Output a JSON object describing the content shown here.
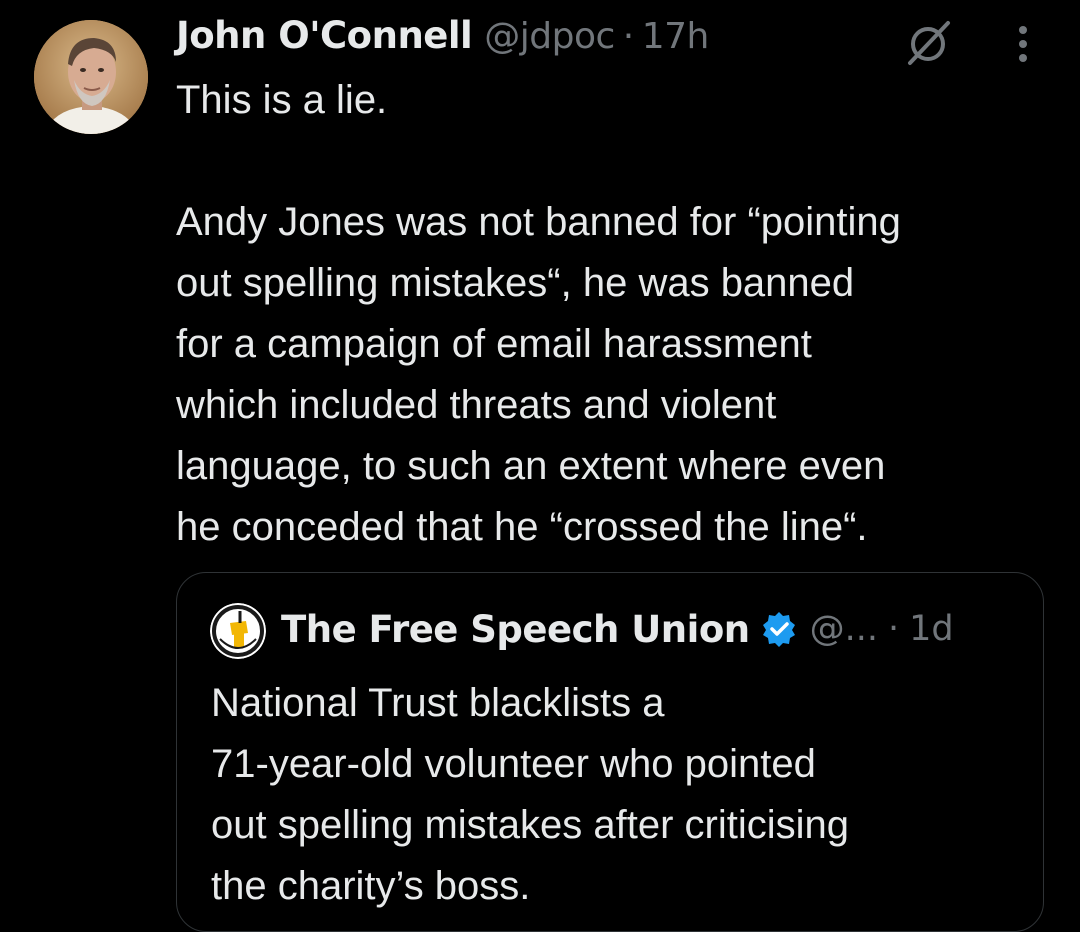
{
  "tweet": {
    "author_name": "John O'Connell",
    "author_handle": "@jdpoc",
    "separator": "·",
    "time": "17h",
    "text_lines": [
      "This is a lie.",
      "",
      "Andy Jones was not banned for “pointing",
      "out spelling mistakes“, he was banned",
      "for a campaign of email harassment",
      "which included threats and violent",
      "language, to such an extent where even",
      "he conceded that he “crossed the line“."
    ]
  },
  "quoted_tweet": {
    "author_name": "The Free Speech Union",
    "author_handle": "@...",
    "separator": "·",
    "time": "1d",
    "text_lines": [
      "National Trust blacklists a",
      "71-year-old volunteer who pointed",
      "out spelling mistakes after criticising",
      "the charity’s boss."
    ]
  },
  "icons": {
    "grok": "grok-icon",
    "more": "more-options-icon",
    "verified": "verified-badge-icon",
    "avatar": "user-avatar",
    "quote_avatar": "free-speech-union-logo"
  },
  "colors": {
    "background": "#000000",
    "text_primary": "#e7e9ea",
    "text_secondary": "#71767b",
    "border": "#2f3336",
    "verified_blue": "#1d9bf0"
  }
}
